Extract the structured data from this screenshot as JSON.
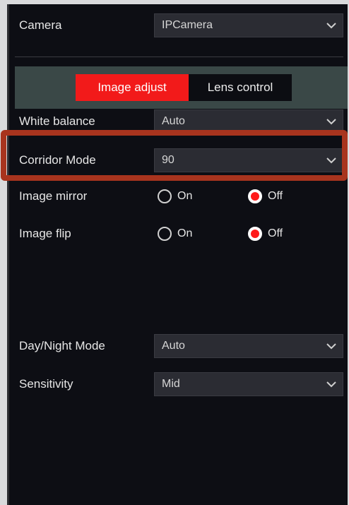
{
  "camera": {
    "label": "Camera",
    "value": "IPCamera"
  },
  "tabs": {
    "image_adjust": "Image adjust",
    "lens_control": "Lens control"
  },
  "white_balance": {
    "label": "White balance",
    "value": "Auto"
  },
  "corridor_mode": {
    "label": "Corridor Mode",
    "value": "90"
  },
  "image_mirror": {
    "label": "Image mirror",
    "on": "On",
    "off": "Off",
    "selected": "Off"
  },
  "image_flip": {
    "label": "Image flip",
    "on": "On",
    "off": "Off",
    "selected": "Off"
  },
  "day_night_mode": {
    "label": "Day/Night Mode",
    "value": "Auto"
  },
  "sensitivity": {
    "label": "Sensitivity",
    "value": "Mid"
  },
  "colors": {
    "accent": "#f21a1a",
    "highlight": "#a8341e",
    "panel": "#0d0e14",
    "tabbar": "#3a4847"
  }
}
